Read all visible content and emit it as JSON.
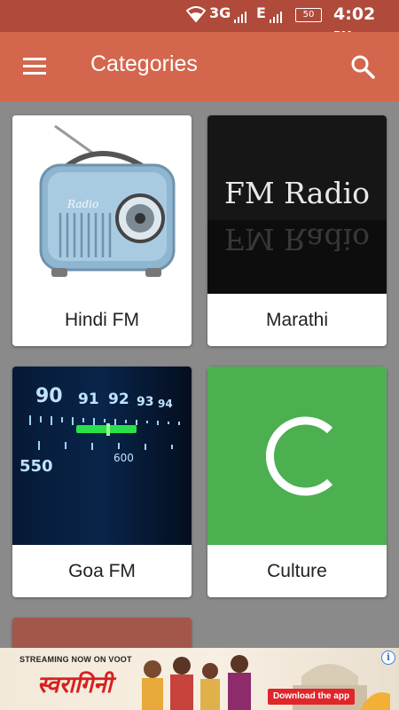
{
  "status_bar": {
    "network_3g": "3G",
    "network_e": "E",
    "battery": "50",
    "time": "4:02",
    "ampm": "PM"
  },
  "app_bar": {
    "title": "Categories",
    "menu_icon": "hamburger-menu-icon",
    "search_icon": "search-icon"
  },
  "categories": [
    {
      "label": "Hindi FM",
      "image": "retro-radio"
    },
    {
      "label": "Marathi",
      "image": "fm-radio-text",
      "image_text": "FM Radio"
    },
    {
      "label": "Goa FM",
      "image": "radio-dial",
      "dial_numbers": [
        "90",
        "91",
        "92",
        "93",
        "94"
      ],
      "dial_lower": [
        "600",
        "550"
      ]
    },
    {
      "label": "Culture",
      "image": "letter-c",
      "letter": "C"
    }
  ],
  "ad": {
    "tagline": "STREAMING NOW ON VOOT",
    "logo_text": "स्वरागिनी",
    "cta": "Download the app",
    "info": "i"
  },
  "colors": {
    "status_bar": "#b04a3a",
    "app_bar": "#d4664d",
    "background": "#8a8a8a",
    "culture_tile": "#4caf50"
  }
}
